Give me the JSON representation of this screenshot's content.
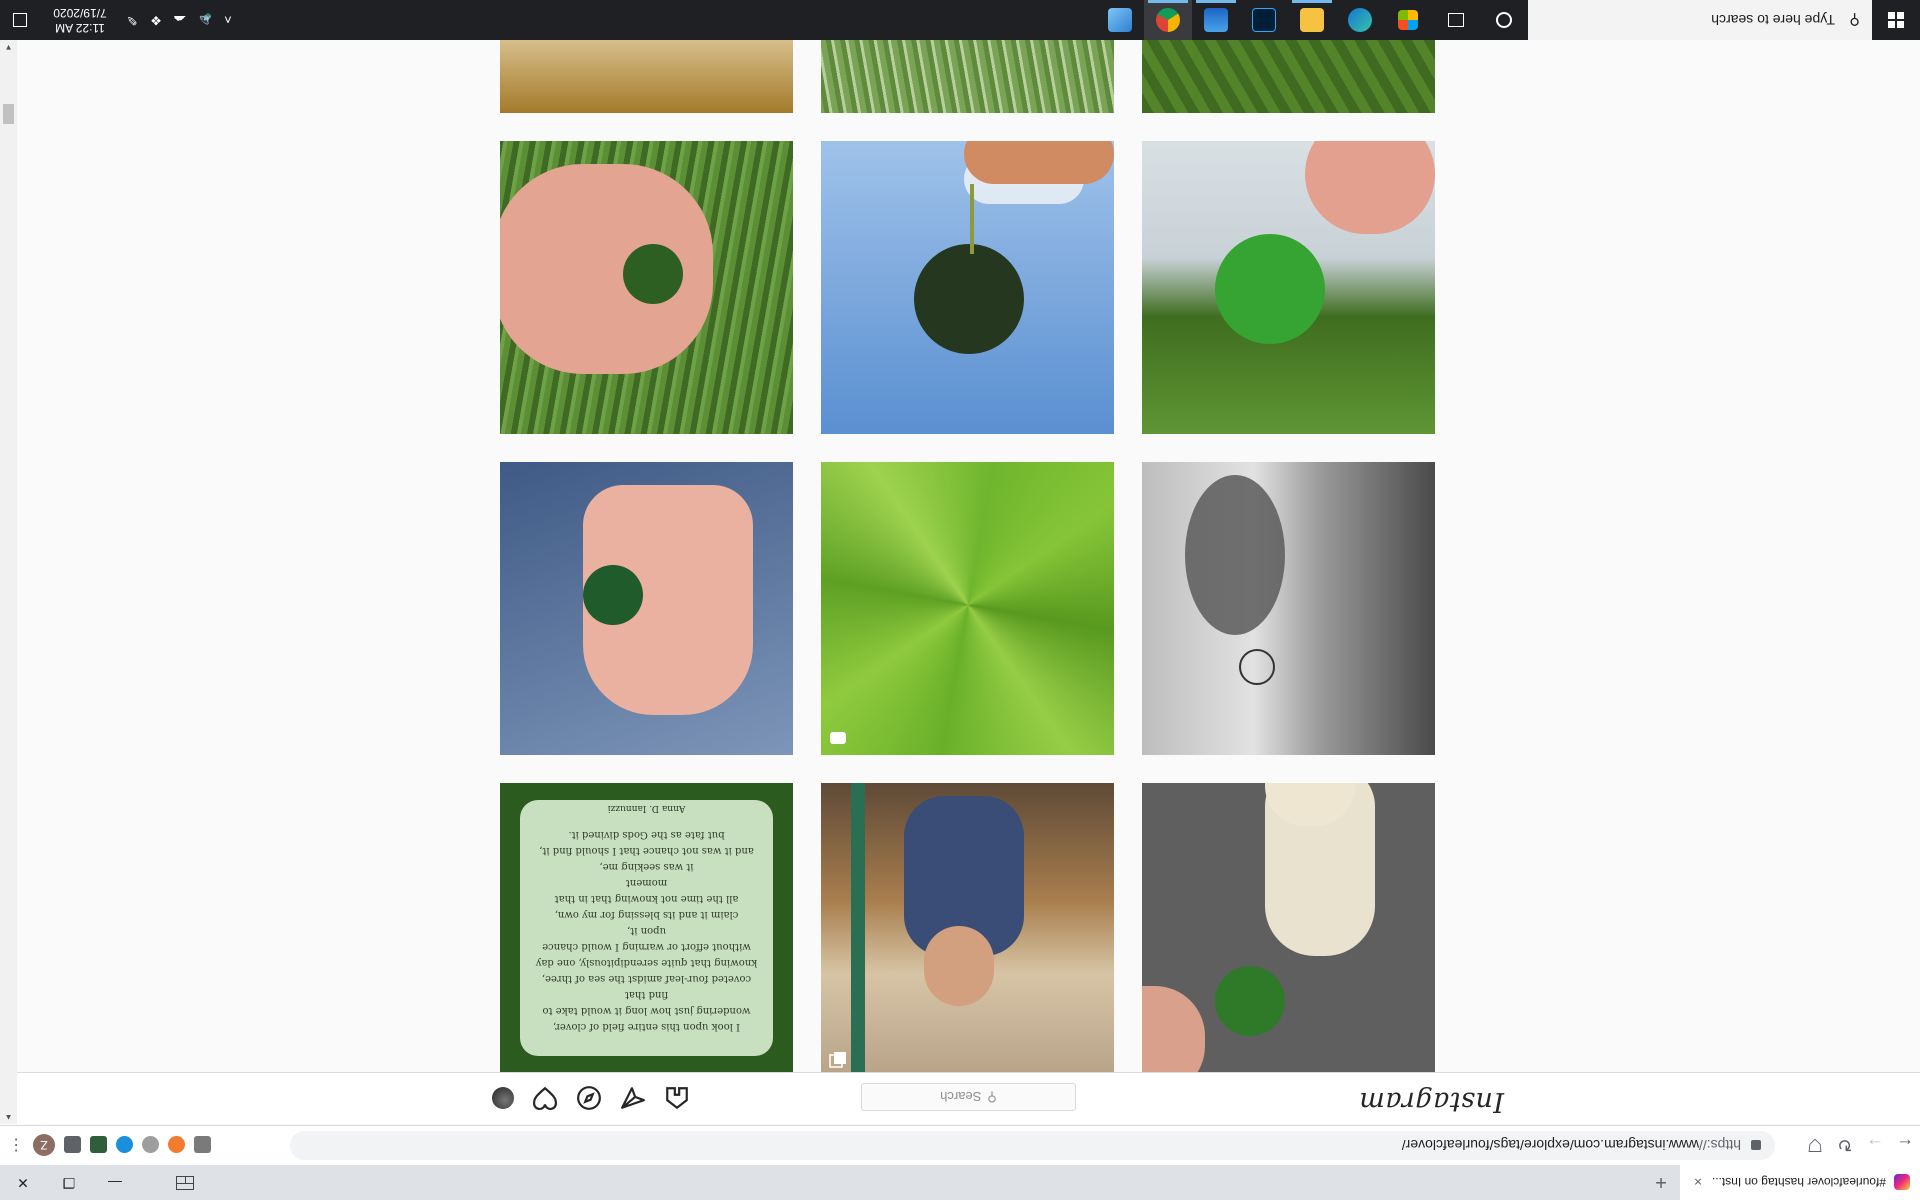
{
  "browser": {
    "tab_title": "#fourleafclover hashtag on Inst...",
    "new_tab": "+",
    "close_tab": "×",
    "url_scheme": "https://",
    "url_rest": "www.instagram.com/explore/tags/fourleafclover/",
    "profile_initial": "Z",
    "window_controls": [
      "—",
      "❐",
      "✕"
    ]
  },
  "instagram": {
    "logo": "Instagram",
    "search_placeholder": "Search",
    "nav_icons": [
      "home-icon",
      "direct-icon",
      "explore-icon",
      "activity-icon",
      "profile-avatar"
    ]
  },
  "poem": {
    "lines": [
      "I look upon this entire field of clover,",
      "wondering just how long it would take to find that",
      "coveted four-leaf amidst the sea of three,",
      "knowing that quite serendipitously, one day",
      "without effort or warning I would chance upon it,",
      "claim it and its blessing for my own,",
      "all the time not knowing that in that moment",
      "it was seeking me,",
      "and it was not chance that I should find it,",
      "but fate as the Gods divined it."
    ],
    "author": "Anna D. Iannuzzi"
  },
  "taskbar": {
    "search_placeholder": "Type here to search",
    "time": "11:22 AM",
    "date": "7/19/2020",
    "apps": [
      "cortana-icon",
      "task-view-icon",
      "microsoft-store-icon",
      "edge-icon",
      "file-explorer-icon",
      "photoshop-icon",
      "photos-icon",
      "chrome-icon",
      "control-panel-icon"
    ]
  },
  "colors": {
    "taskbar_bg": "#1f2023",
    "ig_border": "#dbdbdb",
    "accent_blue": "#76b9ed"
  }
}
